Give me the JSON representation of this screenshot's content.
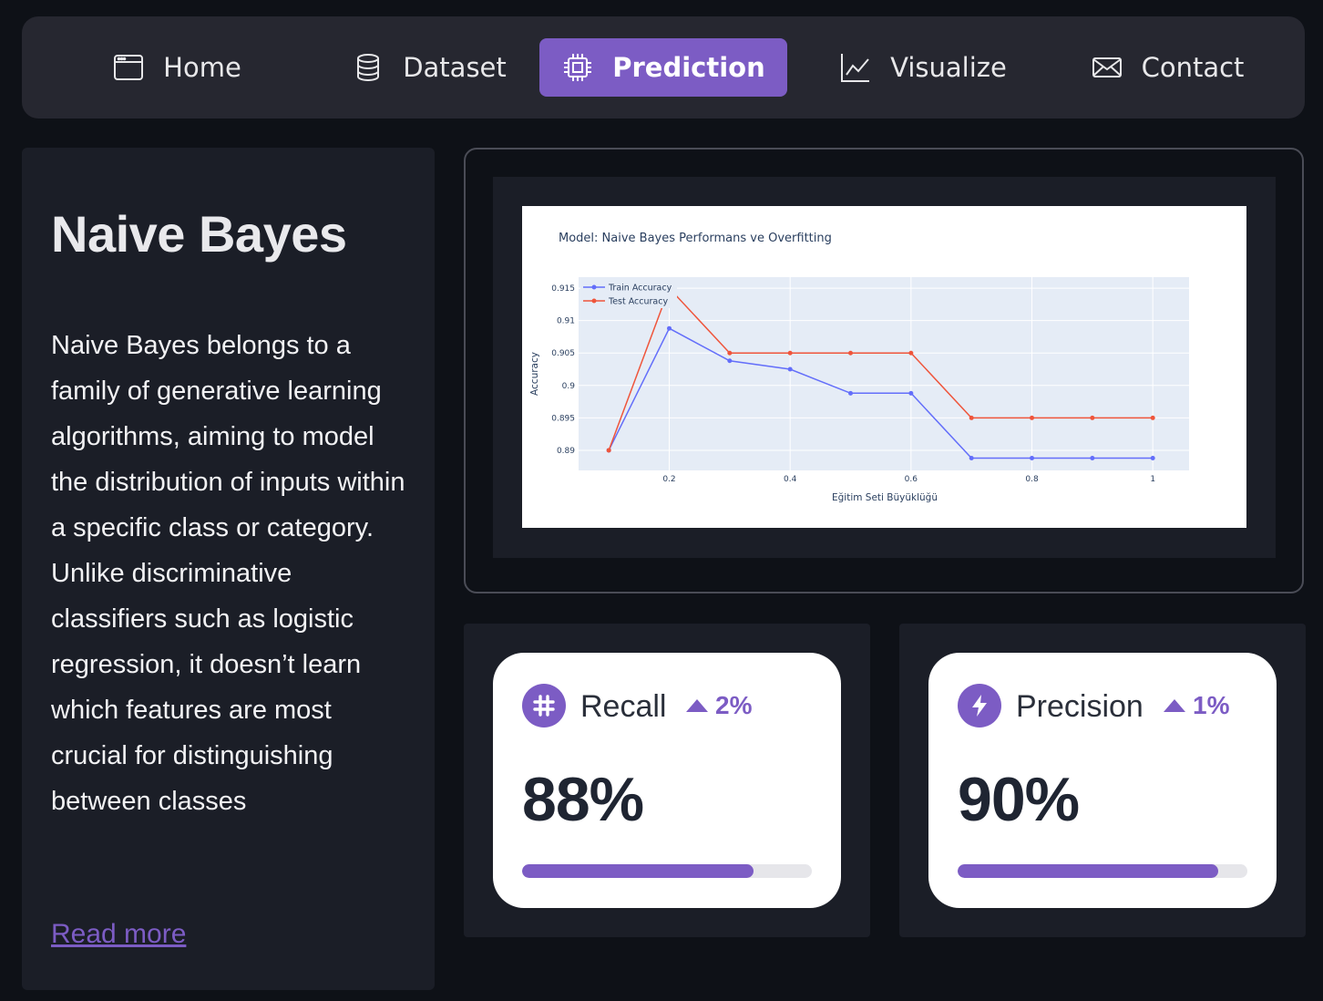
{
  "nav": {
    "items": [
      {
        "label": "Home",
        "icon": "browser-window-icon",
        "active": false
      },
      {
        "label": "Dataset",
        "icon": "database-icon",
        "active": false
      },
      {
        "label": "Prediction",
        "icon": "cpu-chip-icon",
        "active": true
      },
      {
        "label": "Visualize",
        "icon": "line-chart-icon",
        "active": false
      },
      {
        "label": "Contact",
        "icon": "envelope-icon",
        "active": false
      }
    ],
    "active_color": "#7c5cc4"
  },
  "model": {
    "title": "Naive Bayes",
    "description": "Naive Bayes belongs to a family of generative learning algorithms, aiming to model the distribution of inputs within a specific class or category. Unlike discriminative classifiers such as logistic regression, it doesn’t learn which features are most crucial for distinguishing between classes",
    "read_more": "Read more"
  },
  "chart_data": {
    "type": "line",
    "title": "Model: Naive Bayes Performans ve Overfitting",
    "xlabel": "Eğitim Seti Büyüklüğü",
    "ylabel": "Accuracy",
    "xlim": [
      0.05,
      1.06
    ],
    "ylim": [
      0.8869,
      0.9167
    ],
    "x_ticks": [
      "0.2",
      "0.4",
      "0.6",
      "0.8",
      "1"
    ],
    "y_ticks": [
      "0.89",
      "0.895",
      "0.9",
      "0.905",
      "0.91",
      "0.915"
    ],
    "grid": true,
    "legend_position": "top-left",
    "x": [
      0.1,
      0.2,
      0.3,
      0.4,
      0.5,
      0.6,
      0.7,
      0.8,
      0.9,
      1.0
    ],
    "series": [
      {
        "name": "Train Accuracy",
        "color": "#636efa",
        "values": [
          0.89,
          0.9088,
          0.9038,
          0.9025,
          0.8988,
          0.8988,
          0.8888,
          0.8888,
          0.8888,
          0.8888
        ]
      },
      {
        "name": "Test Accuracy",
        "color": "#ef553b",
        "values": [
          0.89,
          0.915,
          0.905,
          0.905,
          0.905,
          0.905,
          0.895,
          0.895,
          0.895,
          0.895
        ]
      }
    ]
  },
  "metrics": [
    {
      "label": "Recall",
      "value": "88%",
      "delta": "2%",
      "progress": 0.8,
      "icon": "slack-icon"
    },
    {
      "label": "Precision",
      "value": "90%",
      "delta": "1%",
      "progress": 0.9,
      "icon": "lightning-icon"
    }
  ]
}
